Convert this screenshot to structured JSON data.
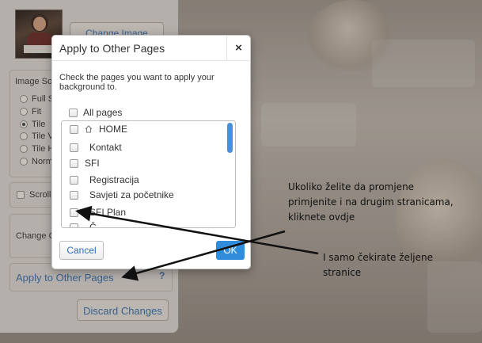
{
  "panel": {
    "change_image_label": "Change Image",
    "image_scaling_label": "Image Sc",
    "scaling_options": [
      {
        "label": "Full S",
        "selected": false
      },
      {
        "label": "Fit",
        "selected": false
      },
      {
        "label": "Tile",
        "selected": true
      },
      {
        "label": "Tile V",
        "selected": false
      },
      {
        "label": "Tile H",
        "selected": false
      },
      {
        "label": "Norm",
        "selected": false
      }
    ],
    "scroll_label": "Scroll",
    "change_color_label": "Change C",
    "apply_link": "Apply to Other Pages",
    "help_label": "?",
    "discard_label": "Discard Changes"
  },
  "modal": {
    "title": "Apply to Other Pages",
    "close_label": "×",
    "instructions": "Check the pages you want to apply your background to.",
    "all_pages_label": "All pages",
    "pages": [
      {
        "label": "HOME",
        "checked": false,
        "icon": "home-icon"
      },
      {
        "label": "Kontakt",
        "checked": false
      },
      {
        "label": "SFI",
        "checked": false
      },
      {
        "label": "Registracija",
        "checked": false
      },
      {
        "label": "Savjeti za početnike",
        "checked": false
      },
      {
        "label": "SFI Plan",
        "checked": false
      },
      {
        "label": "Č",
        "checked": false
      }
    ],
    "cancel_label": "Cancel",
    "ok_label": "OK"
  },
  "annotations": {
    "note1_line1": "Ukoliko želite da promjene",
    "note1_line2": "primjenite i na drugim stranicama,",
    "note1_line3": "kliknete ovdje",
    "note2_line1": "I samo čekirate željene",
    "note2_line2": "stranice"
  },
  "colors": {
    "link_blue": "#3d6fa8",
    "ok_blue": "#2f8ddb",
    "scroll_thumb": "#4a90d9"
  }
}
